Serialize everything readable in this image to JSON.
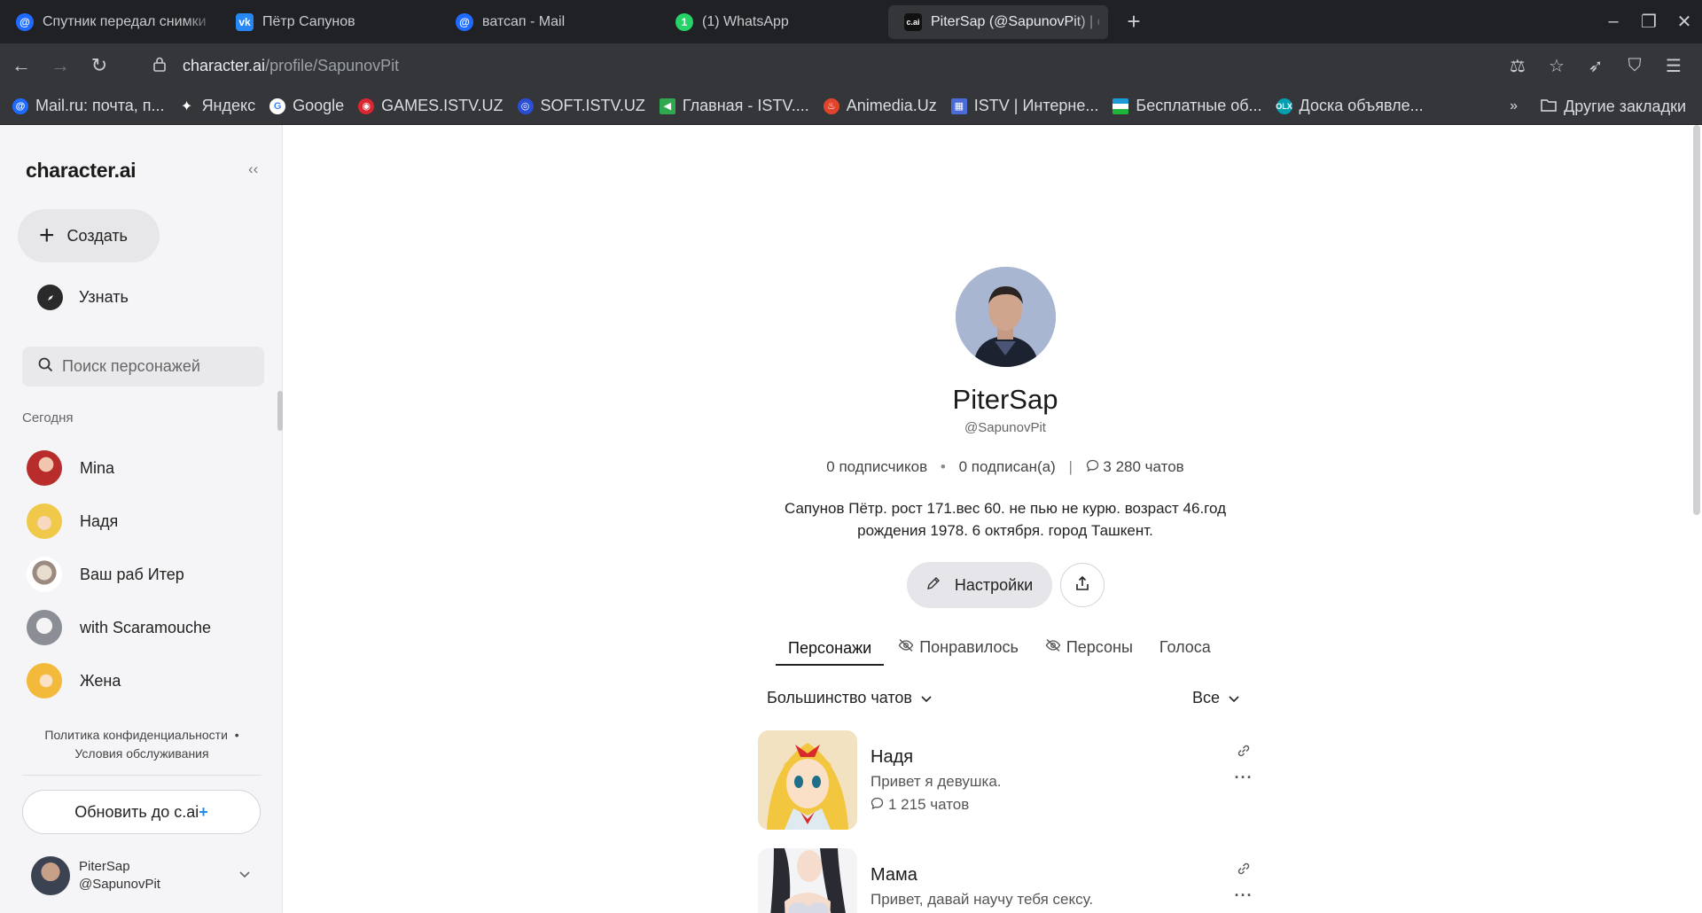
{
  "browser": {
    "tabs": [
      {
        "label": "Спутник передал снимки Вс",
        "icon": "mail-at-icon",
        "color": "#1f6bff"
      },
      {
        "label": "Пётр Сапунов",
        "icon": "vk-icon",
        "color": "#2787f5"
      },
      {
        "label": "ватсап - Mail",
        "icon": "mail-at-icon",
        "color": "#1f6bff"
      },
      {
        "label": "(1) WhatsApp",
        "icon": "whatsapp-icon",
        "color": "#25d366"
      },
      {
        "label": "PiterSap (@SapunovPit) | cha",
        "icon": "cai-icon",
        "color": "#111111"
      }
    ],
    "url_host": "character.ai",
    "url_path": "/profile/SapunovPit",
    "bookmarks": [
      {
        "label": "Mail.ru: почта, п...",
        "color": "#1f6bff"
      },
      {
        "label": "Яндекс",
        "color": "#333333"
      },
      {
        "label": "Google",
        "color": "#4285f4"
      },
      {
        "label": "GAMES.ISTV.UZ",
        "color": "#d9262f"
      },
      {
        "label": "SOFT.ISTV.UZ",
        "color": "#2a4fd6"
      },
      {
        "label": "Главная - ISTV....",
        "color": "#2fa84f"
      },
      {
        "label": "Animedia.Uz",
        "color": "#e0452b"
      },
      {
        "label": "ISTV | Интерне...",
        "color": "#4a6bd9"
      },
      {
        "label": "Бесплатные об...",
        "color": "#1eb53a"
      },
      {
        "label": "Доска объявле...",
        "color": "#00a0b0"
      }
    ],
    "bookmarks_more": "»",
    "other_bookmarks": "Другие закладки"
  },
  "sidebar": {
    "brand": "character.ai",
    "create_label": "Создать",
    "learn_label": "Узнать",
    "search_placeholder": "Поиск персонажей",
    "section_today": "Сегодня",
    "chats": [
      {
        "name": "Mina",
        "color": "#c33a3a"
      },
      {
        "name": "Надя",
        "color": "#f0c84a"
      },
      {
        "name": "Ваш раб Итер",
        "color": "#d8d2cc"
      },
      {
        "name": "with Scaramouche",
        "color": "#bfc3c8"
      },
      {
        "name": "Жена",
        "color": "#f2b93b"
      }
    ],
    "privacy_link": "Политика конфиденциальности",
    "terms_link": "Условия обслуживания",
    "upgrade_label": "Обновить до c.ai",
    "upgrade_plus": "+",
    "user_name": "PiterSap",
    "user_handle": "@SapunovPit"
  },
  "profile": {
    "name": "PiterSap",
    "handle": "@SapunovPit",
    "followers": "0 подписчиков",
    "following": "0 подписан(а)",
    "chats": "3 280 чатов",
    "bio": "Сапунов Пётр. рост 171.вес 60. не пью не курю. возраст 46.год рождения 1978. 6 октября. город Ташкент.",
    "settings_label": "Настройки",
    "tabs": [
      "Персонажи",
      "Понравилось",
      "Персоны",
      "Голоса"
    ],
    "sort_label": "Большинство чатов",
    "filter_label": "Все",
    "characters": [
      {
        "name": "Надя",
        "description": "Привет я девушка.",
        "chats": "1 215 чатов"
      },
      {
        "name": "Мама",
        "description": "Привет, давай научу тебя сексу.",
        "chats": ""
      }
    ]
  }
}
